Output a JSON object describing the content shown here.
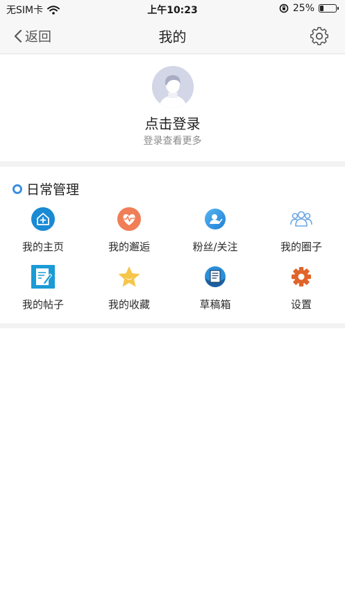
{
  "status_bar": {
    "carrier": "无SIM卡",
    "time": "上午10:23",
    "battery": "25%",
    "battery_level": 0.25
  },
  "nav": {
    "back_label": "返回",
    "title": "我的"
  },
  "profile": {
    "login_label": "点击登录",
    "login_hint": "登录查看更多"
  },
  "daily": {
    "title": "日常管理",
    "items": [
      {
        "label": "我的主页",
        "icon": "home-icon",
        "color": "#1a8ad4"
      },
      {
        "label": "我的邂逅",
        "icon": "heart-pulse-icon",
        "color": "#f07e56"
      },
      {
        "label": "粉丝/关注",
        "icon": "fans-icon",
        "color": "#3a9ee6"
      },
      {
        "label": "我的圈子",
        "icon": "group-icon",
        "color": "#7fb3e8"
      },
      {
        "label": "我的帖子",
        "icon": "post-edit-icon",
        "color": "#1b9bd6"
      },
      {
        "label": "我的收藏",
        "icon": "star-icon",
        "color": "#f5c042"
      },
      {
        "label": "草稿箱",
        "icon": "drafts-icon",
        "color": "#2b8fd9"
      },
      {
        "label": "设置",
        "icon": "gear-icon",
        "color": "#e0642a"
      }
    ]
  }
}
